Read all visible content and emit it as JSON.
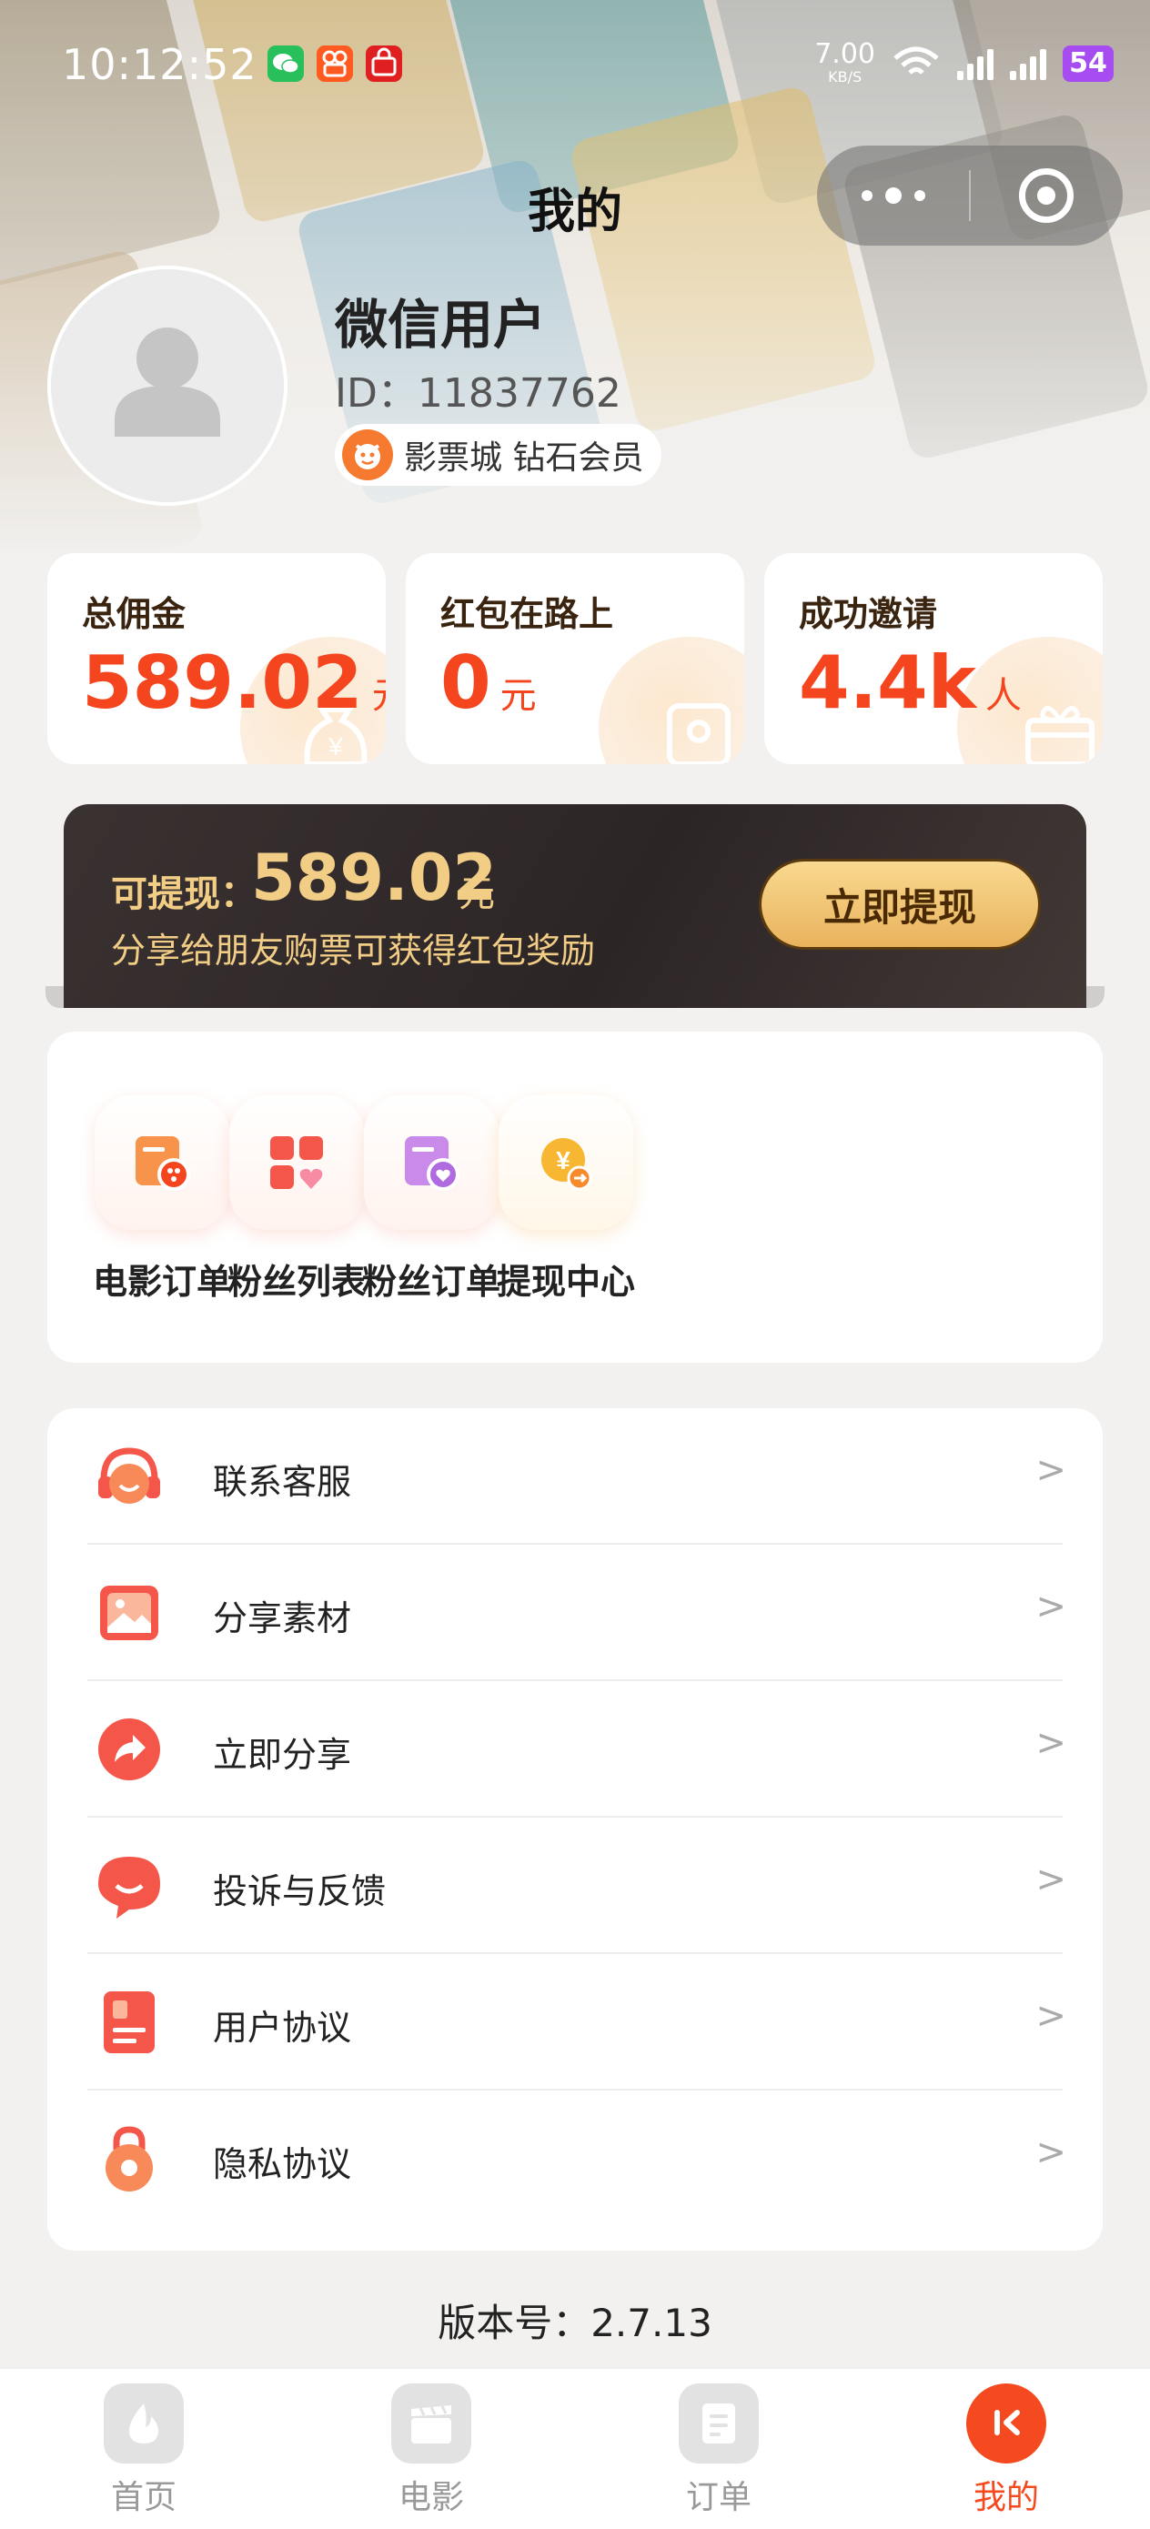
{
  "status_bar": {
    "time": "10:12:52",
    "net_speed_value": "7.00",
    "net_speed_unit": "KB/S",
    "battery": "54"
  },
  "page": {
    "title": "我的"
  },
  "profile": {
    "name": "微信用户",
    "id_text": "ID：11837762",
    "vip_text": "影票城 钻石会员"
  },
  "stats": [
    {
      "title": "总佣金",
      "value": "589.02",
      "unit": "元"
    },
    {
      "title": "红包在路上",
      "value": "0",
      "unit": "元"
    },
    {
      "title": "成功邀请",
      "value": "4.4k",
      "unit": "人"
    }
  ],
  "withdraw": {
    "label": "可提现：",
    "amount": "589.02",
    "unit": "元",
    "tip": "分享给朋友购票可获得红包奖励",
    "button": "立即提现"
  },
  "quick_actions": [
    {
      "label": "电影订单",
      "icon": "movie-order-icon"
    },
    {
      "label": "粉丝列表",
      "icon": "fans-list-icon"
    },
    {
      "label": "粉丝订单",
      "icon": "fans-order-icon"
    },
    {
      "label": "提现中心",
      "icon": "withdraw-center-icon"
    }
  ],
  "menu": [
    {
      "label": "联系客服",
      "icon": "headset-icon"
    },
    {
      "label": "分享素材",
      "icon": "image-icon"
    },
    {
      "label": "立即分享",
      "icon": "share-icon"
    },
    {
      "label": "投诉与反馈",
      "icon": "feedback-icon"
    },
    {
      "label": "用户协议",
      "icon": "document-icon"
    },
    {
      "label": "隐私协议",
      "icon": "lock-icon"
    }
  ],
  "menu_arrow": ">",
  "version": "版本号：2.7.13",
  "tabs": [
    {
      "label": "首页",
      "active": false
    },
    {
      "label": "电影",
      "active": false
    },
    {
      "label": "订单",
      "active": false
    },
    {
      "label": "我的",
      "active": true
    }
  ],
  "colors": {
    "accent": "#f5491f",
    "gold": "#f2cd86",
    "banner_dark": "#2c2526"
  }
}
